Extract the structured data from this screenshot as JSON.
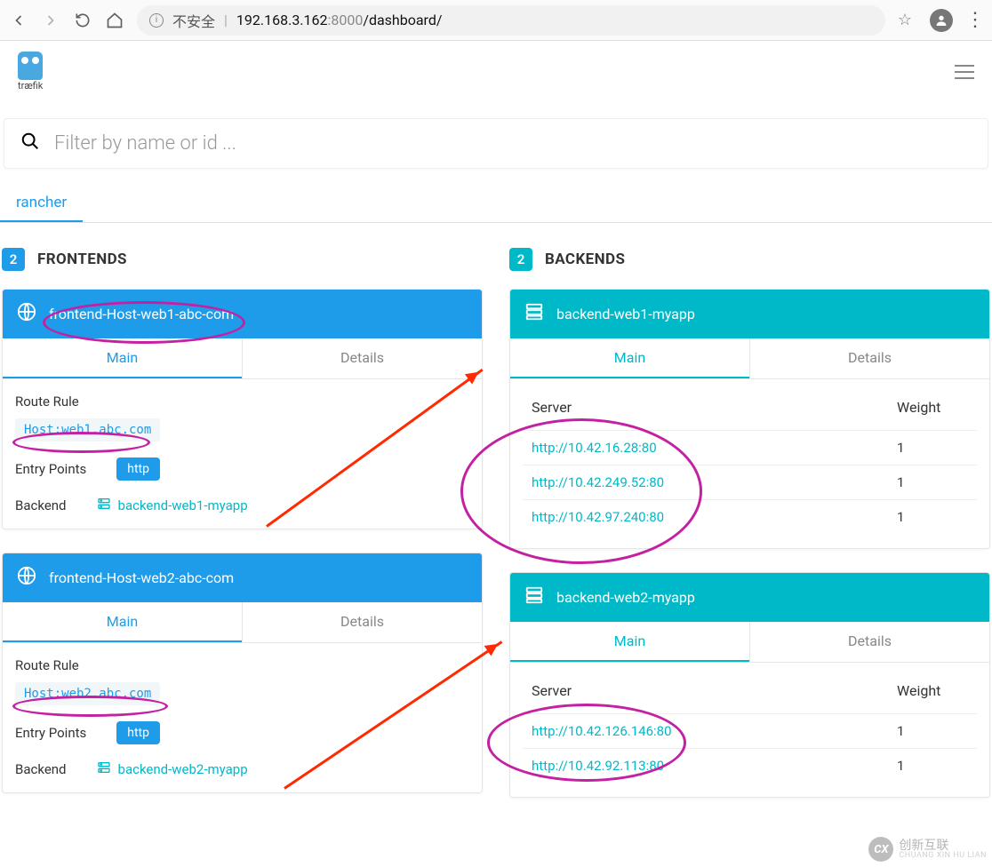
{
  "browser": {
    "insecure_label": "不安全",
    "addr_host": "192.168.3.162",
    "addr_port": ":8000",
    "addr_path": "/dashboard/"
  },
  "page": {
    "logo_text": "træfik",
    "search_placeholder": "Filter by name or id ...",
    "provider_tab": "rancher"
  },
  "frontends": {
    "title": "FRONTENDS",
    "count": "2",
    "tabs": {
      "main": "Main",
      "details": "Details"
    },
    "labels": {
      "route_rule": "Route Rule",
      "entry_points": "Entry Points",
      "backend": "Backend"
    },
    "items": [
      {
        "name": "frontend-Host-web1-abc-com",
        "rule": "Host:web1.abc.com",
        "entry_point": "http",
        "backend_link": "backend-web1-myapp"
      },
      {
        "name": "frontend-Host-web2-abc-com",
        "rule": "Host:web2.abc.com",
        "entry_point": "http",
        "backend_link": "backend-web2-myapp"
      }
    ]
  },
  "backends": {
    "title": "BACKENDS",
    "count": "2",
    "tabs": {
      "main": "Main",
      "details": "Details"
    },
    "columns": {
      "server": "Server",
      "weight": "Weight"
    },
    "items": [
      {
        "name": "backend-web1-myapp",
        "servers": [
          {
            "url": "http://10.42.16.28:80",
            "weight": "1"
          },
          {
            "url": "http://10.42.249.52:80",
            "weight": "1"
          },
          {
            "url": "http://10.42.97.240:80",
            "weight": "1"
          }
        ]
      },
      {
        "name": "backend-web2-myapp",
        "servers": [
          {
            "url": "http://10.42.126.146:80",
            "weight": "1"
          },
          {
            "url": "http://10.42.92.113:80",
            "weight": "1"
          }
        ]
      }
    ]
  },
  "watermark": {
    "cn": "创新互联",
    "en": "CHUANG XIN HU LIAN"
  }
}
